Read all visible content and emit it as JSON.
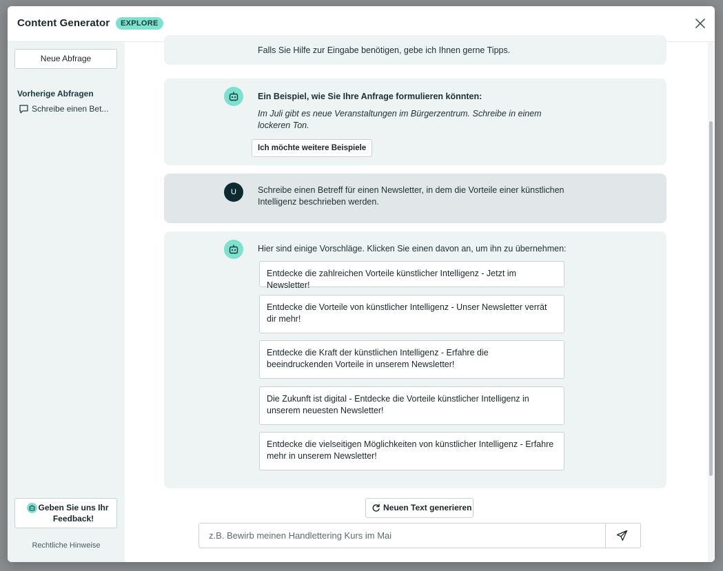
{
  "modal": {
    "title": "Content Generator",
    "badge": "EXPLORE",
    "colors": {
      "accent": "#7ee0cf",
      "dark": "#0d2a30",
      "panel": "#eef3f4"
    }
  },
  "sidebar": {
    "new_query_label": "Neue Abfrage",
    "previous_title": "Vorherige Abfragen",
    "previous_items": [
      {
        "label": "Schreibe einen Bet...",
        "icon": "chat-bubble-icon"
      }
    ],
    "feedback_label": "Geben Sie uns Ihr Feedback!",
    "legal_label": "Rechtliche Hinweise"
  },
  "chat": {
    "intro_partial": "Falls Sie Hilfe zur Eingabe benötigen, gebe ich Ihnen gerne Tipps.",
    "example": {
      "heading": "Ein Beispiel, wie Sie Ihre Anfrage formulieren könnten:",
      "text": "Im Juli gibt es neue Veranstaltungen im Bürgerzentrum. Schreibe in einem lockeren Ton.",
      "more_button": "Ich möchte weitere Beispiele"
    },
    "user_message": {
      "avatar_initial": "U",
      "text": "Schreibe einen Betreff für einen Newsletter, in dem die Vorteile einer künstlichen Intelligenz beschrieben werden."
    },
    "reply": {
      "intro": "Hier sind einige Vorschläge. Klicken Sie einen davon an, um ihn zu übernehmen:",
      "suggestions": [
        "Entdecke die zahlreichen Vorteile künstlicher Intelligenz - Jetzt im Newsletter!",
        "Entdecke die Vorteile von künstlicher Intelligenz - Unser Newsletter verrät dir mehr!",
        "Entdecke die Kraft der künstlichen Intelligenz - Erfahre die beeindruckenden Vorteile in unserem Newsletter!",
        "Die Zukunft ist digital - Entdecke die Vorteile künstlicher Intelligenz in unserem neuesten Newsletter!",
        "Entdecke die vielseitigen Möglichkeiten von künstlicher Intelligenz - Erfahre mehr in unserem Newsletter!"
      ]
    },
    "regenerate_label": "Neuen Text generieren",
    "input_placeholder": "z.B. Bewirb meinen Handlettering Kurs im Mai",
    "input_value": ""
  }
}
